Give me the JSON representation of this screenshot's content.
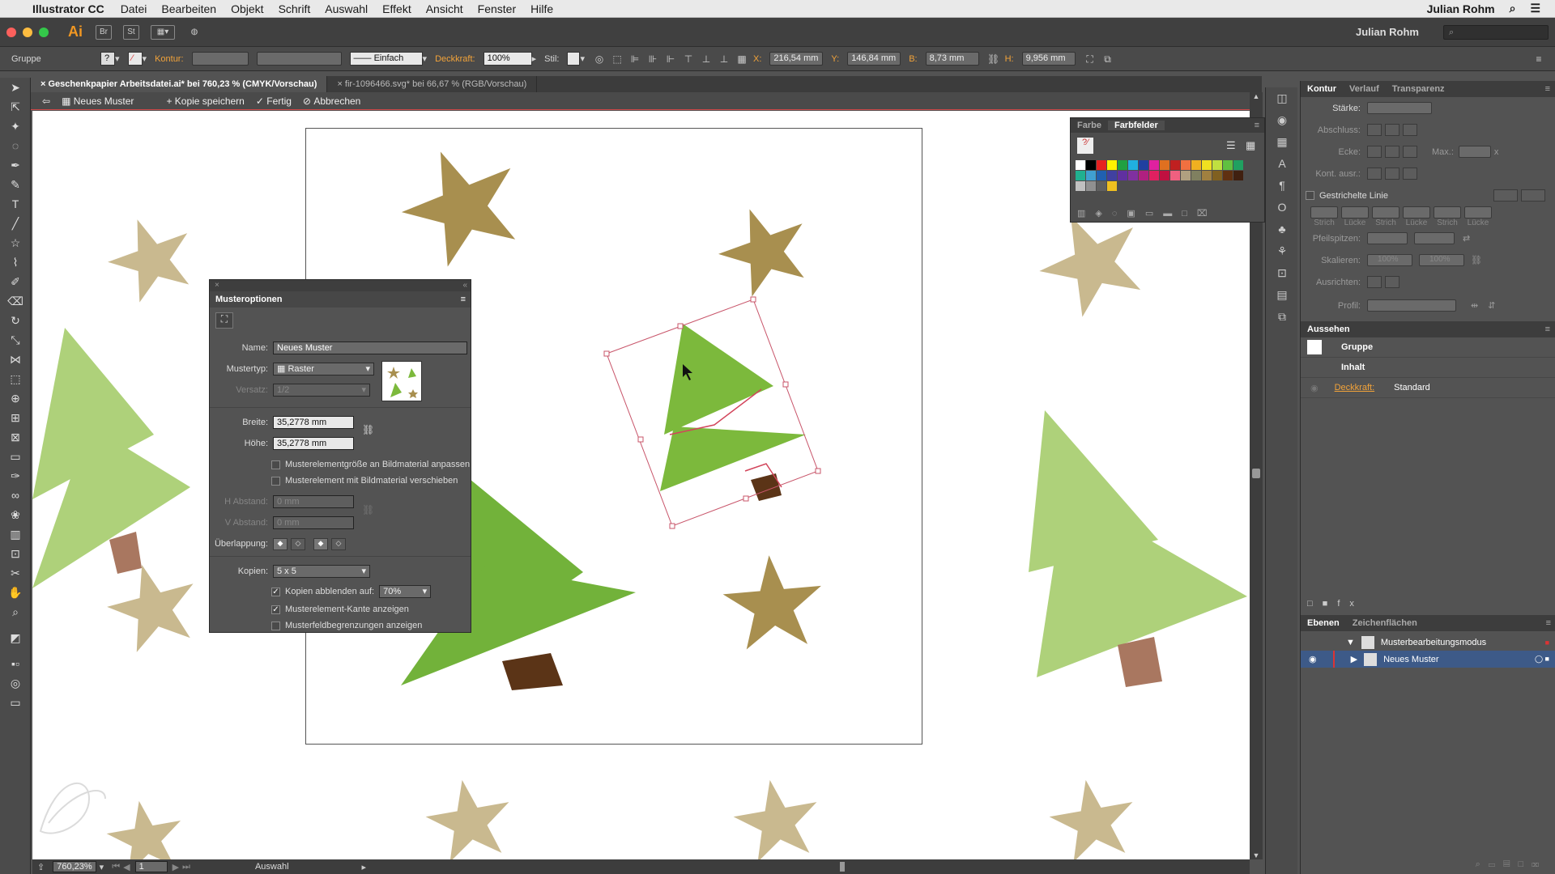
{
  "menubar": {
    "app": "Illustrator CC",
    "items": [
      "Datei",
      "Bearbeiten",
      "Objekt",
      "Schrift",
      "Auswahl",
      "Effekt",
      "Ansicht",
      "Fenster",
      "Hilfe"
    ],
    "user": "Julian Rohm"
  },
  "appbar": {
    "logo": "Ai",
    "bridge": "Br",
    "stock": "St",
    "user": "Julian Rohm"
  },
  "control": {
    "selection": "Gruppe",
    "kontur_label": "Kontur:",
    "stroke_style": "Einfach",
    "deckkraft_label": "Deckkraft:",
    "deckkraft_value": "100%",
    "stil_label": "Stil:",
    "x_label": "X:",
    "x_value": "216,54 mm",
    "y_label": "Y:",
    "y_value": "146,84 mm",
    "b_label": "B:",
    "b_value": "8,73 mm",
    "h_label": "H:",
    "h_value": "9,956 mm"
  },
  "tabs": [
    {
      "label": "Geschenkpapier Arbeitsdatei.ai* bei 760,23 % (CMYK/Vorschau)",
      "active": true
    },
    {
      "label": "fir-1096466.svg* bei 66,67 % (RGB/Vorschau)",
      "active": false
    }
  ],
  "isolation": {
    "name": "Neues Muster",
    "save_copy": "Kopie speichern",
    "done": "Fertig",
    "cancel": "Abbrechen"
  },
  "musteroptionen": {
    "title": "Musteroptionen",
    "name_label": "Name:",
    "name_value": "Neues Muster",
    "type_label": "Mustertyp:",
    "type_value": "Raster",
    "versatz_label": "Versatz:",
    "versatz_value": "1/2",
    "breite_label": "Breite:",
    "breite_value": "35,2778 mm",
    "hoehe_label": "Höhe:",
    "hoehe_value": "35,2778 mm",
    "cb_resize": "Musterelementgröße an Bildmaterial anpassen",
    "cb_move": "Musterelement mit Bildmaterial verschieben",
    "habstand_label": "H Abstand:",
    "habstand_value": "0 mm",
    "vabstand_label": "V Abstand:",
    "vabstand_value": "0 mm",
    "overlap_label": "Überlappung:",
    "kopien_label": "Kopien:",
    "kopien_value": "5 x 5",
    "dim_label": "Kopien abblenden auf:",
    "dim_value": "70%",
    "cb_edge": "Musterelement-Kante anzeigen",
    "cb_bounds": "Musterfeldbegrenzungen anzeigen"
  },
  "swatches": {
    "tab_farbe": "Farbe",
    "tab_felder": "Farbfelder",
    "colors": [
      "#ffffff",
      "#000000",
      "#e62020",
      "#fff200",
      "#20a040",
      "#20b0e0",
      "#2040a0",
      "#e020a0",
      "#e07020",
      "#c02020",
      "#f07040",
      "#f0b020",
      "#f0e020",
      "#c0e040",
      "#60c040",
      "#20a060",
      "#20b090",
      "#40a0d0",
      "#2060b0",
      "#4040a0",
      "#6030a0",
      "#8030a0",
      "#b02080",
      "#e02060",
      "#c01040",
      "#f06080",
      "#b0a080",
      "#808060",
      "#a08040",
      "#806020",
      "#603010",
      "#402010",
      "#c0c0c0",
      "#909090",
      "#606060",
      "#f0c020"
    ]
  },
  "kontur": {
    "tabs": [
      "Kontur",
      "Verlauf",
      "Transparenz"
    ],
    "staerke": "Stärke:",
    "abschluss": "Abschluss:",
    "ecke": "Ecke:",
    "max": "Max.:",
    "max_unit": "x",
    "kont_ausr": "Kont. ausr.:",
    "gestrichelt": "Gestrichelte Linie",
    "dash_labels": [
      "Strich",
      "Lücke",
      "Strich",
      "Lücke",
      "Strich",
      "Lücke"
    ],
    "pfeilspitzen": "Pfeilspitzen:",
    "skalieren": "Skalieren:",
    "skal_val": "100%",
    "ausrichten": "Ausrichten:",
    "profil": "Profil:"
  },
  "aussehen": {
    "title": "Aussehen",
    "group": "Gruppe",
    "inhalt": "Inhalt",
    "deckkraft": "Deckkraft:",
    "standard": "Standard"
  },
  "ebenen": {
    "tabs": [
      "Ebenen",
      "Zeichenflächen"
    ],
    "layer1": "Musterbearbeitungsmodus",
    "layer2": "Neues Muster"
  },
  "statusbar": {
    "zoom": "760,23%",
    "page": "1",
    "tool": "Auswahl"
  }
}
